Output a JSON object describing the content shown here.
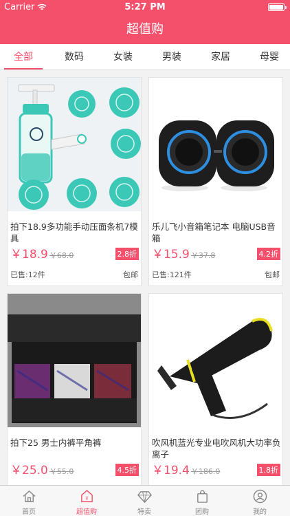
{
  "status_bar": {
    "carrier": "Carrier",
    "time": "5:27 PM"
  },
  "nav": {
    "title": "超值购"
  },
  "tabs": [
    {
      "label": "全部",
      "active": true
    },
    {
      "label": "数码"
    },
    {
      "label": "女装"
    },
    {
      "label": "男装"
    },
    {
      "label": "家居"
    },
    {
      "label": "母婴"
    }
  ],
  "products": [
    {
      "title": "拍下18.9多功能手动压面条机7模具",
      "price": "￥18.9",
      "old_price": "￥68.0",
      "discount": "2.8折",
      "sold": "已售:12件",
      "shipping": "包邮",
      "image": "noodle-press-icon"
    },
    {
      "title": "乐儿飞小音箱笔记本 电脑USB音箱",
      "price": "￥15.9",
      "old_price": "￥37.8",
      "discount": "4.2折",
      "sold": "已售:121件",
      "shipping": "包邮",
      "image": "speaker-icon"
    },
    {
      "title": "拍下25 男士内裤平角裤",
      "price": "￥25.0",
      "old_price": "￥55.0",
      "discount": "4.5折",
      "image": "underwear-icon"
    },
    {
      "title": "吹风机蓝光专业电吹风机大功率负离子",
      "price": "￥19.4",
      "old_price": "￥186.0",
      "discount": "1.8折",
      "image": "hairdryer-icon"
    }
  ],
  "tabbar": [
    {
      "label": "首页",
      "icon": "home-icon"
    },
    {
      "label": "超值购",
      "icon": "deal-tag-icon",
      "active": true
    },
    {
      "label": "特卖",
      "icon": "diamond-icon"
    },
    {
      "label": "团购",
      "icon": "bag-icon"
    },
    {
      "label": "我的",
      "icon": "user-icon"
    }
  ],
  "colors": {
    "accent": "#f4506c"
  }
}
